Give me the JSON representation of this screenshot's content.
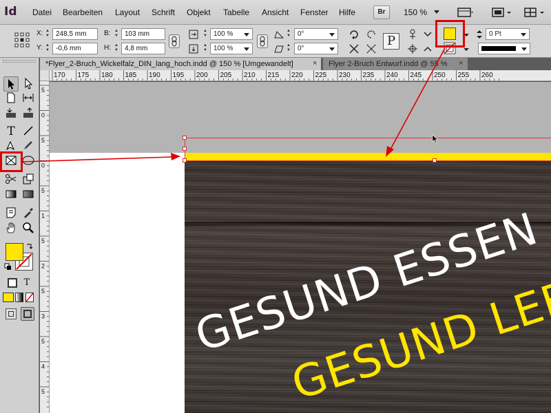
{
  "app": {
    "logo": "Id"
  },
  "menu": [
    "Datei",
    "Bearbeiten",
    "Layout",
    "Schrift",
    "Objekt",
    "Tabelle",
    "Ansicht",
    "Fenster",
    "Hilfe"
  ],
  "menubar": {
    "bridge_label": "Br",
    "zoom": "150 %"
  },
  "control": {
    "x_label": "X:",
    "x_value": "248,5 mm",
    "y_label": "Y:",
    "y_value": "-0,6 mm",
    "w_label": "B:",
    "w_value": "103 mm",
    "h_label": "H:",
    "h_value": "4,8 mm",
    "scale_x": "100 %",
    "scale_y": "100 %",
    "rotate": "0°",
    "shear": "0°",
    "stroke_weight": "0 Pt",
    "paragraph_icon_label": "P",
    "fill_color": "#ffe500"
  },
  "tabs": [
    {
      "label": "*Flyer_2-Bruch_Wickelfalz_DIN_lang_hoch.indd @ 150 % [Umgewandelt]",
      "active": true
    },
    {
      "label": "Flyer 2-Bruch Entwurf.indd @ 55 %",
      "active": false
    }
  ],
  "ruler_top": [
    "170",
    "175",
    "180",
    "185",
    "190",
    "195",
    "200",
    "205",
    "210",
    "215",
    "220",
    "225",
    "230",
    "235",
    "240",
    "245",
    "250",
    "255",
    "260"
  ],
  "ruler_left": [
    "5",
    "0",
    "5",
    "0",
    "5",
    "1",
    "5",
    "2",
    "5",
    "3",
    "5",
    "4",
    "5"
  ],
  "canvas": {
    "headline_1": "GESUND ESSEN",
    "headline_2": "GESUND LEBEN"
  },
  "tools": {
    "type_label": "T",
    "fill_swatch_color": "#ffe500",
    "text_format_label": "T"
  },
  "annotation_color": "#e00000"
}
